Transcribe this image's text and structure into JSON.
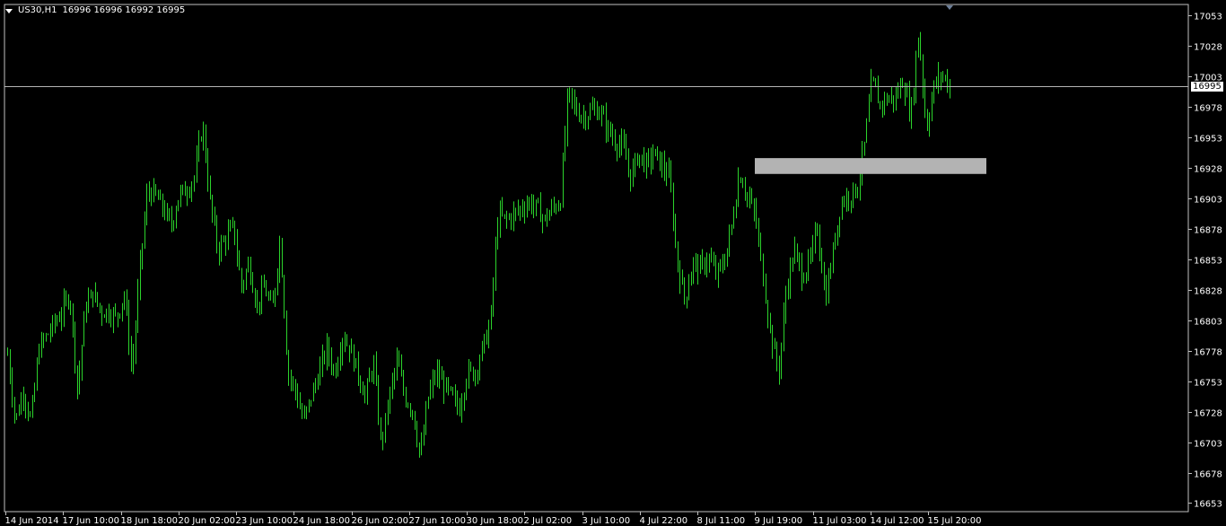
{
  "header": {
    "symbol_timeframe": "US30,H1",
    "ohlc": "16996 16996 16992 16995"
  },
  "current_price_label": "16995",
  "colors": {
    "background": "#000000",
    "candles": "#2bd32b",
    "axis": "#c0c0c0",
    "text": "#ffffff",
    "zone": "#b3b3b3",
    "price_line": "#b3b3b3"
  },
  "chart_data": {
    "type": "bar",
    "title": "US30,H1",
    "y_ticks": [
      17053,
      17028,
      17003,
      16978,
      16953,
      16928,
      16903,
      16878,
      16853,
      16828,
      16803,
      16778,
      16753,
      16728,
      16703,
      16678,
      16653
    ],
    "ylim": [
      16646,
      17062
    ],
    "x_ticks": [
      "14 Jun 2014",
      "17 Jun 10:00",
      "18 Jun 18:00",
      "20 Jun 02:00",
      "23 Jun 10:00",
      "24 Jun 18:00",
      "26 Jun 02:00",
      "27 Jun 10:00",
      "30 Jun 18:00",
      "2 Jul 02:00",
      "3 Jul 10:00",
      "4 Jul 22:00",
      "8 Jul 11:00",
      "9 Jul 19:00",
      "11 Jul 03:00",
      "14 Jul 12:00",
      "15 Jul 20:00"
    ],
    "current_price": 16995,
    "zone": {
      "from": 16923,
      "to": 16936
    },
    "close_path": [
      16775,
      16720,
      16745,
      16720,
      16780,
      16790,
      16800,
      16810,
      16825,
      16745,
      16815,
      16825,
      16810,
      16810,
      16805,
      16825,
      16760,
      16845,
      16910,
      16905,
      16895,
      16880,
      16905,
      16910,
      16920,
      16965,
      16900,
      16860,
      16870,
      16880,
      16830,
      16850,
      16815,
      16830,
      16810,
      16870,
      16760,
      16745,
      16720,
      16740,
      16760,
      16780,
      16760,
      16790,
      16780,
      16760,
      16740,
      16770,
      16700,
      16740,
      16770,
      16740,
      16730,
      16690,
      16740,
      16760,
      16750,
      16740,
      16730,
      16760,
      16760,
      16780,
      16800,
      16890,
      16885,
      16890,
      16895,
      16900,
      16895,
      16885,
      16895,
      16900,
      16990,
      16975,
      16970,
      16975,
      16975,
      16960,
      16950,
      16945,
      16920,
      16940,
      16930,
      16940,
      16930,
      16920,
      16850,
      16820,
      16850,
      16845,
      16855,
      16840,
      16850,
      16880,
      16925,
      16905,
      16890,
      16840,
      16790,
      16760,
      16830,
      16860,
      16840,
      16850,
      16880,
      16820,
      16860,
      16900,
      16905,
      16910,
      16945,
      17000,
      16980,
      16985,
      16985,
      17000,
      16970,
      17040,
      16960,
      16995,
      17005,
      16995
    ]
  }
}
